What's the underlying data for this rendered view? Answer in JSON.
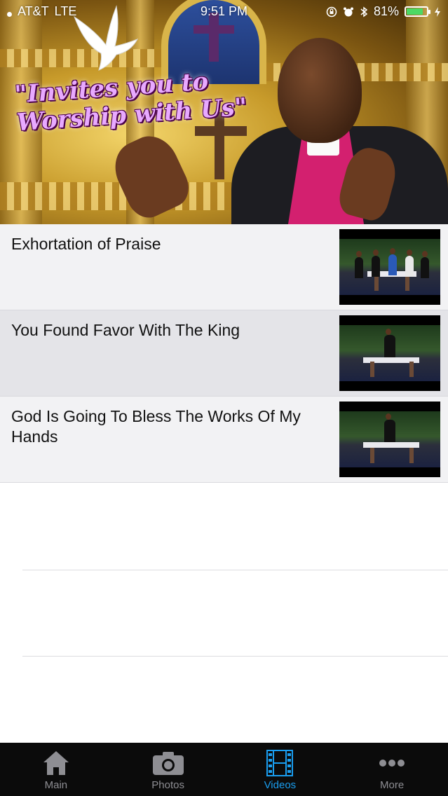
{
  "status_bar": {
    "carrier": "AT&T",
    "network": "LTE",
    "time": "9:51 PM",
    "battery": "81%",
    "battery_level": 0.81
  },
  "hero": {
    "tagline_line1": "\"Invites you to",
    "tagline_line2": "Worship with Us\""
  },
  "videos": [
    {
      "title": "Exhortation of Praise"
    },
    {
      "title": "You Found Favor With The King"
    },
    {
      "title": "God Is Going To Bless The Works Of My Hands"
    }
  ],
  "tabbar": {
    "tabs": [
      {
        "label": "Main",
        "icon": "home-icon"
      },
      {
        "label": "Photos",
        "icon": "camera-icon"
      },
      {
        "label": "Videos",
        "icon": "film-icon"
      },
      {
        "label": "More",
        "icon": "more-dots-icon"
      }
    ],
    "active_index": 2
  },
  "colors": {
    "accent": "#1a9ef0",
    "tab_inactive": "#8e8e93",
    "tabbar_bg": "#0b0b0b",
    "row_bg": "#f2f2f4",
    "row_selected_bg": "#e4e4e8",
    "battery_green": "#4cd964"
  }
}
